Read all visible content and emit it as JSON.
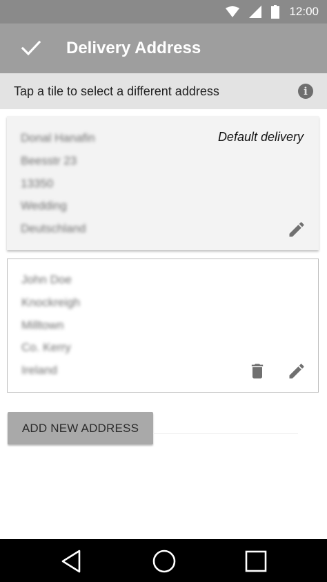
{
  "status_bar": {
    "time": "12:00",
    "icons": [
      "wifi-icon",
      "signal-icon",
      "battery-icon"
    ]
  },
  "app_bar": {
    "title": "Delivery Address",
    "confirm_icon": "check-icon"
  },
  "hint": {
    "text": "Tap a tile to select a different address",
    "icon": "info-icon"
  },
  "addresses": [
    {
      "selected": true,
      "badge": "Default delivery",
      "lines": [
        "Donal Hanafin",
        "Beesstr 23",
        "13350",
        "Wedding",
        "Deutschland"
      ],
      "actions": [
        "edit-icon"
      ]
    },
    {
      "selected": false,
      "badge": "",
      "lines": [
        "John Doe",
        "Knockreigh",
        "Milltown",
        "Co. Kerry",
        "Ireland"
      ],
      "actions": [
        "delete-icon",
        "edit-icon"
      ]
    }
  ],
  "add_button": {
    "label": "ADD NEW ADDRESS"
  },
  "nav_bar": {
    "icons": [
      "back-icon",
      "home-icon",
      "recents-icon"
    ]
  },
  "colors": {
    "status_bar": "#8a8a8a",
    "app_bar": "#9e9e9e",
    "hint_bar": "#e3e3e3",
    "selected_card": "#f3f3f3",
    "button": "#a9a9a9",
    "icon": "#707070"
  }
}
